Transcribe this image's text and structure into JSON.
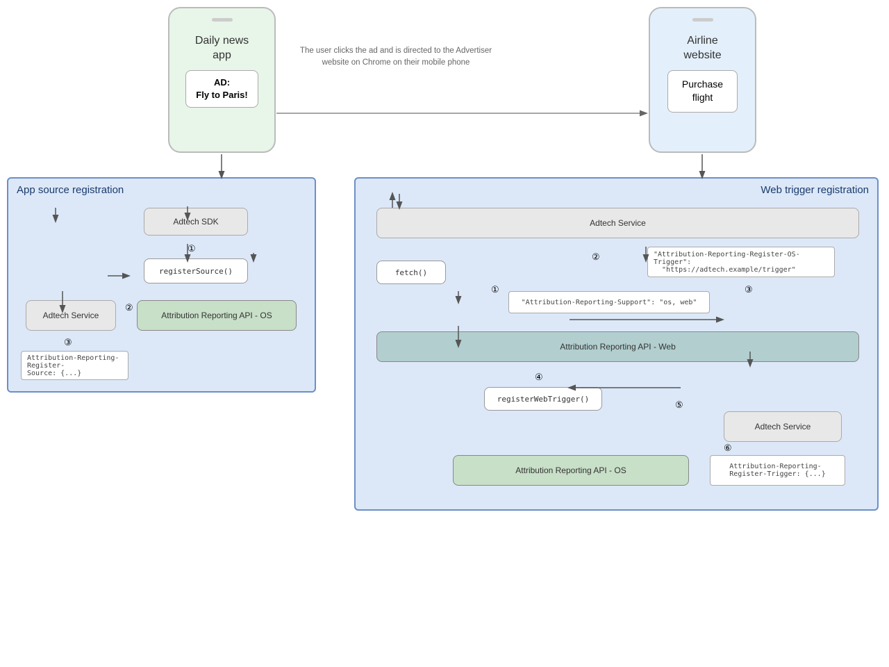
{
  "phones": {
    "left": {
      "title": "Daily news\napp",
      "screen_bg": "green",
      "ad_label": "AD:",
      "ad_text": "Fly to Paris!"
    },
    "right": {
      "title": "Airline\nwebsite",
      "screen_bg": "blue",
      "purchase_label": "Purchase\nflight"
    }
  },
  "annotation": {
    "text": "The user clicks the ad and is directed to\nthe Advertiser website on Chrome on\ntheir mobile phone"
  },
  "app_source": {
    "title": "App source registration",
    "adtech_sdk": "Adtech SDK",
    "adtech_service": "Adtech Service",
    "register_source": "registerSource()",
    "attribution_os": "Attribution Reporting API - OS",
    "attr_register_source": "Attribution-Reporting-Register-\nSource: {...}",
    "step1": "①",
    "step2": "②",
    "step3": "③"
  },
  "web_trigger": {
    "title": "Web trigger registration",
    "adtech_service_top": "Adtech Service",
    "fetch": "fetch()",
    "attr_support": "\"Attribution-Reporting-Support\": \"os, web\"",
    "attr_os_trigger": "\"Attribution-Reporting-Register-OS-Trigger\":\n\"https://adtech.example/trigger\"",
    "attribution_web": "Attribution Reporting API - Web",
    "register_web_trigger": "registerWebTrigger()",
    "adtech_service_bottom": "Adtech Service",
    "attr_register_trigger": "Attribution-Reporting-\nRegister-Trigger: {...}",
    "attribution_os": "Attribution Reporting API - OS",
    "step1": "①",
    "step2": "②",
    "step3": "③",
    "step4": "④",
    "step5": "⑤",
    "step6": "⑥"
  }
}
